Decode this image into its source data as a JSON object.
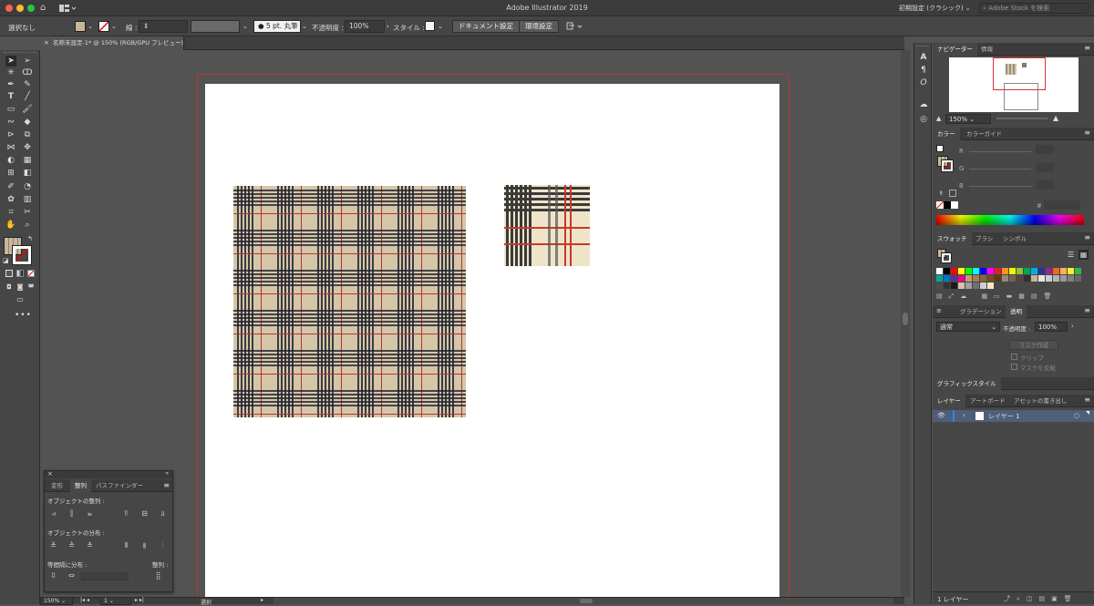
{
  "app": {
    "title": "Adobe Illustrator 2019",
    "workspace": "初期設定 (クラシック)",
    "search_placeholder": "Adobe Stock を検索"
  },
  "control_bar": {
    "selection": "選択なし",
    "stroke_label": "線 :",
    "brush": "5 pt. 丸筆",
    "opacity_label": "不透明度 :",
    "opacity_value": "100%",
    "style_label": "スタイル :",
    "doc_setup": "ドキュメント設定",
    "preferences": "環境設定"
  },
  "document_tab": {
    "title": "名称未設定-1* @ 150% (RGB/GPU プレビュー)"
  },
  "navigator": {
    "tabs": [
      "ナビゲーター",
      "情報"
    ],
    "zoom": "150%"
  },
  "color_panel": {
    "tabs": [
      "カラー",
      "カラーガイド"
    ],
    "channels": [
      "R",
      "G",
      "B"
    ],
    "hex_prefix": "#"
  },
  "swatches_panel": {
    "tabs": [
      "スウォッチ",
      "ブラシ",
      "シンボル"
    ],
    "colors": [
      "#ffffff",
      "#000000",
      "#ff0000",
      "#ffff00",
      "#00ff00",
      "#00ffff",
      "#0000ff",
      "#ff00ff",
      "#ed1c24",
      "#f7941d",
      "#fff200",
      "#8dc63f",
      "#00a651",
      "#00aeef",
      "#2e3192",
      "#92278f",
      "#f26522",
      "#fbaf5d",
      "#f9ed32",
      "#39b54a",
      "#00a99d",
      "#0072bc",
      "#662d91",
      "#ec008c",
      "#c69c6d",
      "#a67c52",
      "#8c6239",
      "#754c24",
      "#603913",
      "#998675",
      "#736357",
      "#534741",
      "#362f2d",
      "#c7b299",
      "#e6e6e6",
      "#cccccc",
      "#b3b3b3",
      "#999999",
      "#808080",
      "#666666",
      "#4d4d4d",
      "#333333",
      "#1a1a1a",
      "#d4c4a8",
      "#a0a0a0",
      "#707070",
      "#cfcfcf",
      "#ffe4c4"
    ]
  },
  "transparency_panel": {
    "tabs": [
      "グラデーション",
      "透明"
    ],
    "blend_mode": "通常",
    "opacity_label": "不透明度 :",
    "opacity_value": "100%",
    "make_mask": "マスク作成",
    "clip": "クリップ",
    "invert_mask": "マスクを反転"
  },
  "graphic_styles": {
    "title": "グラフィックスタイル"
  },
  "layers_panel": {
    "tabs": [
      "レイヤー",
      "アートボード",
      "アセットの書き出し"
    ],
    "layer_name": "レイヤー 1",
    "count": "1 レイヤー"
  },
  "align_panel": {
    "tabs": [
      "変形",
      "整列",
      "パスファインダー"
    ],
    "align_objects": "オブジェクトの整列 :",
    "distribute_objects": "オブジェクトの分布 :",
    "distribute_spacing": "等間隔に分布 :",
    "align_to": "整列 :"
  },
  "status_bar": {
    "zoom": "150%",
    "artboard": "1",
    "tool": "選択"
  },
  "colors": {
    "plaid_base": "#d6c6a8",
    "plaid_dark": "#1f2230",
    "plaid_red": "#b3362e",
    "panel_bg": "#474747",
    "layer_row": "#4f5f79"
  }
}
